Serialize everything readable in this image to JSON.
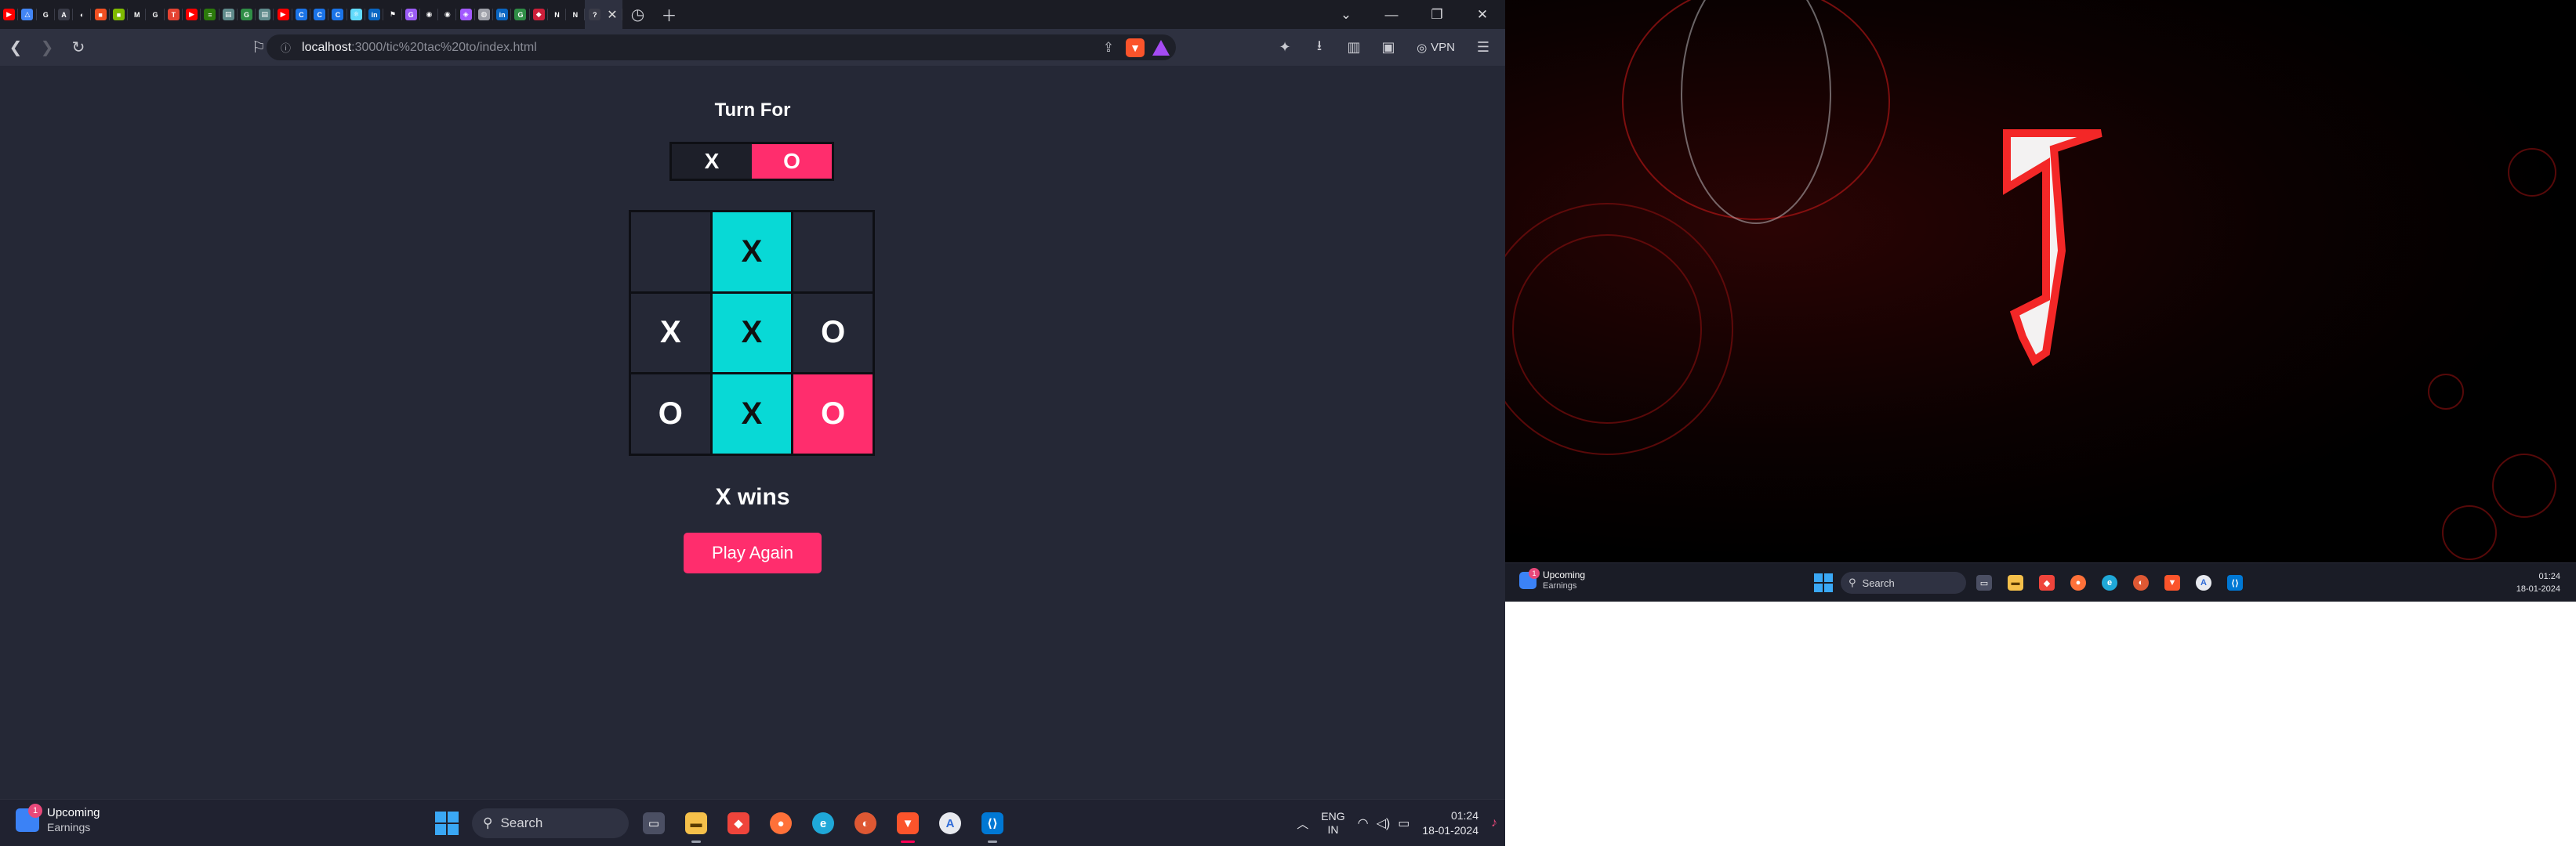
{
  "browser": {
    "tab_favicons": [
      {
        "icon": "youtube-icon",
        "color": "#ff0000",
        "glyph": "▶"
      },
      {
        "icon": "google-drive-icon",
        "color": "#4285f4",
        "glyph": "△"
      },
      {
        "icon": "google-icon",
        "color": "#ffffff",
        "glyph": "G"
      },
      {
        "icon": "font-icon",
        "color": "#3a3c48",
        "glyph": "A"
      },
      {
        "icon": "github-copilot-icon",
        "color": "#ffffff",
        "glyph": "◐"
      },
      {
        "icon": "microsoft-icon",
        "color": "#f25022",
        "glyph": "■"
      },
      {
        "icon": "windows-icon",
        "color": "#7fba00",
        "glyph": "■"
      },
      {
        "icon": "medium-icon",
        "color": "#ffffff",
        "glyph": "M"
      },
      {
        "icon": "google-icon",
        "color": "#ffffff",
        "glyph": "G"
      },
      {
        "icon": "todoist-icon",
        "color": "#e44332",
        "glyph": "T"
      },
      {
        "icon": "youtube-icon",
        "color": "#ff0000",
        "glyph": "▶"
      },
      {
        "icon": "code-icon",
        "color": "#2b7a0b",
        "glyph": "≡"
      },
      {
        "icon": "docs-icon",
        "color": "#5f8a8b",
        "glyph": "▤"
      },
      {
        "icon": "geeksforgeeks-icon",
        "color": "#2f8d46",
        "glyph": "G"
      },
      {
        "icon": "docs-icon",
        "color": "#5f8a8b",
        "glyph": "▤"
      },
      {
        "icon": "youtube-icon",
        "color": "#ff0000",
        "glyph": "▶"
      },
      {
        "icon": "codechef-icon",
        "color": "#1a73e8",
        "glyph": "C"
      },
      {
        "icon": "codechef-icon",
        "color": "#1a73e8",
        "glyph": "C"
      },
      {
        "icon": "codechef-icon",
        "color": "#1a73e8",
        "glyph": "C"
      },
      {
        "icon": "react-icon",
        "color": "#61dafb",
        "glyph": "⚛"
      },
      {
        "icon": "linkedin-icon",
        "color": "#0a66c2",
        "glyph": "in"
      },
      {
        "icon": "flag-icon",
        "color": "#ffffff",
        "glyph": "⚑"
      },
      {
        "icon": "grammarly-icon",
        "color": "#9b5cf6",
        "glyph": "G"
      },
      {
        "icon": "github-icon",
        "color": "#ffffff",
        "glyph": "◉"
      },
      {
        "icon": "github-icon",
        "color": "#ffffff",
        "glyph": "◉"
      },
      {
        "icon": "figma-icon",
        "color": "#a259ff",
        "glyph": "◈"
      },
      {
        "icon": "globe-icon",
        "color": "#9ea0a9",
        "glyph": "◍"
      },
      {
        "icon": "linkedin-icon",
        "color": "#0a66c2",
        "glyph": "in"
      },
      {
        "icon": "geeksforgeeks-icon",
        "color": "#2f8d46",
        "glyph": "G"
      },
      {
        "icon": "antivirus-icon",
        "color": "#cc1f3a",
        "glyph": "◆"
      },
      {
        "icon": "notion-icon",
        "color": "#ffffff",
        "glyph": "N"
      },
      {
        "icon": "notion-icon",
        "color": "#ffffff",
        "glyph": "N"
      }
    ],
    "url_host": "localhost",
    "url_path": ":3000/tic%20tac%20to/index.html",
    "vpn_label": "VPN"
  },
  "game": {
    "turn_title": "Turn For",
    "turn_x": "X",
    "turn_o": "O",
    "current_turn": "O",
    "board": [
      "",
      "X",
      "",
      "X",
      "X",
      "O",
      "O",
      "X",
      "O"
    ],
    "winning_cells": [
      1,
      4,
      7
    ],
    "last_move_cell": 8,
    "result": "X wins",
    "play_again": "Play Again",
    "accent_color": "#ff2d6d",
    "win_color": "#08d9d6"
  },
  "taskbar": {
    "widget_badge": "1",
    "widget_title": "Upcoming",
    "widget_sub": "Earnings",
    "search_label": "Search",
    "lang_top": "ENG",
    "lang_bottom": "IN",
    "time": "01:24",
    "date": "18-01-2024"
  },
  "taskbar2": {
    "widget_badge": "1",
    "widget_title": "Upcoming",
    "widget_sub": "Earnings",
    "search_label": "Search",
    "time": "01:24",
    "date": "18-01-2024"
  }
}
